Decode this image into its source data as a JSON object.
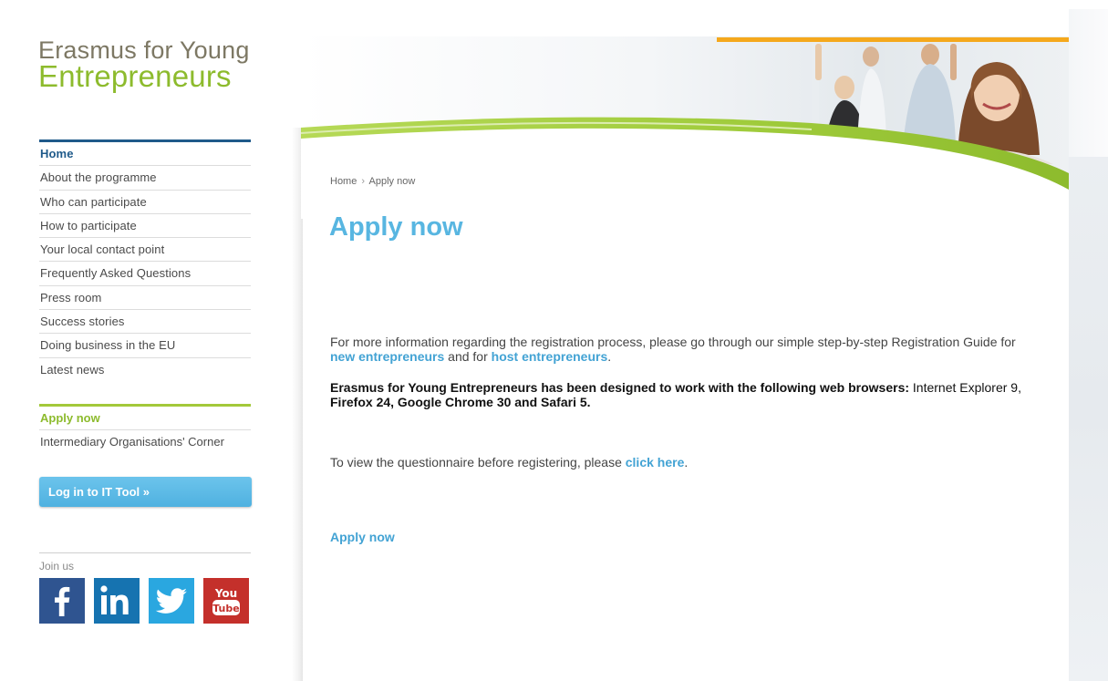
{
  "logo": {
    "line1": "Erasmus for Young",
    "line2": "Entrepreneurs"
  },
  "nav": {
    "items": [
      {
        "label": "Home",
        "active": true
      },
      {
        "label": "About the programme"
      },
      {
        "label": "Who can participate"
      },
      {
        "label": "How to participate"
      },
      {
        "label": "Your local contact point"
      },
      {
        "label": "Frequently Asked Questions"
      },
      {
        "label": "Press room"
      },
      {
        "label": "Success stories"
      },
      {
        "label": "Doing business in the EU"
      },
      {
        "label": "Latest news"
      }
    ],
    "secondary": [
      {
        "label": "Apply now",
        "active": true
      },
      {
        "label": "Intermediary Organisations' Corner"
      }
    ]
  },
  "login_button": "Log in to IT Tool »",
  "join": {
    "label": "Join us",
    "icons": [
      "facebook-icon",
      "linkedin-icon",
      "twitter-icon",
      "youtube-icon"
    ]
  },
  "breadcrumb": {
    "home": "Home",
    "separator": "›",
    "current": "Apply now"
  },
  "page_title": "Apply now",
  "content": {
    "p1_text_a": "For more information regarding the registration process, please go through our simple step-by-step Registration Guide for ",
    "p1_link1": "new entrepreneurs",
    "p1_text_b": " and for ",
    "p1_link2": "host entrepreneurs",
    "p1_text_c": ".",
    "p2_bold": "Erasmus for Young Entrepreneurs has been designed to work with the following web browsers:",
    "p2_text_a": " Internet Explorer 9, ",
    "p2_bold2": "Firefox 24, Google Chrome 30 and Safari 5.",
    "p3_text": "To view the questionnaire before registering, please ",
    "p3_link": "click here",
    "p3_end": ".",
    "apply_link": "Apply now"
  },
  "colors": {
    "accent_blue": "#58b6e1",
    "link_blue": "#43a3d4",
    "nav_blue": "#1f5a8a",
    "brand_green": "#8dbb2d",
    "logo_grey": "#7d7864",
    "orange": "#f5a81c"
  }
}
